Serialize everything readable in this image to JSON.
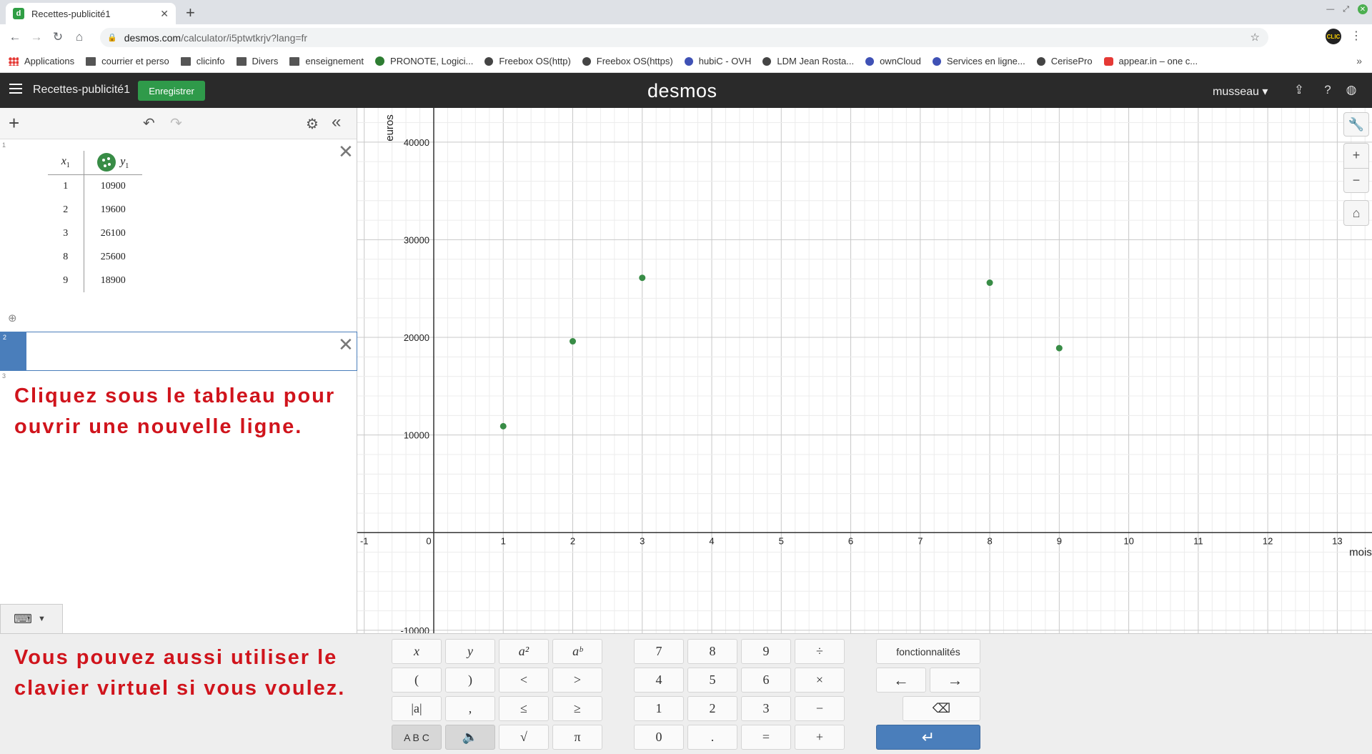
{
  "browser": {
    "tab_title": "Recettes-publicité1",
    "url_host": "desmos.com",
    "url_path": "/calculator/i5ptwtkrjv?lang=fr",
    "bookmarks": [
      {
        "label": "Applications",
        "icon": "apps"
      },
      {
        "label": "courrier et perso",
        "icon": "folder"
      },
      {
        "label": "clicinfo",
        "icon": "folder"
      },
      {
        "label": "Divers",
        "icon": "folder"
      },
      {
        "label": "enseignement",
        "icon": "folder"
      },
      {
        "label": "PRONOTE, Logici...",
        "icon": "green"
      },
      {
        "label": "Freebox OS(http)",
        "icon": "dot"
      },
      {
        "label": "Freebox OS(https)",
        "icon": "dot"
      },
      {
        "label": "hubiC - OVH",
        "icon": "blue"
      },
      {
        "label": "LDM Jean Rosta...",
        "icon": "dot"
      },
      {
        "label": "ownCloud",
        "icon": "blue"
      },
      {
        "label": "Services en ligne...",
        "icon": "blue"
      },
      {
        "label": "CerisePro",
        "icon": "dot"
      },
      {
        "label": "appear.in – one c...",
        "icon": "red"
      }
    ]
  },
  "header": {
    "graph_title": "Recettes-publicité1",
    "save_label": "Enregistrer",
    "logo": "desmos",
    "user": "musseau"
  },
  "expressions": {
    "row_numbers": [
      "1",
      "2",
      "3"
    ],
    "table": {
      "col1_header": "x",
      "col1_sub": "1",
      "col2_header": "y",
      "col2_sub": "1",
      "rows": [
        {
          "x": "1",
          "y": "10900"
        },
        {
          "x": "2",
          "y": "19600"
        },
        {
          "x": "3",
          "y": "26100"
        },
        {
          "x": "8",
          "y": "25600"
        },
        {
          "x": "9",
          "y": "18900"
        }
      ],
      "point_color": "#388c46"
    }
  },
  "annotations": {
    "top": [
      "Cliquez sous le tableau pour",
      "ouvrir une nouvelle ligne."
    ],
    "bottom": [
      "Vous pouvez aussi utiliser le",
      "clavier virtuel si vous voulez."
    ]
  },
  "chart_data": {
    "type": "scatter",
    "xlabel": "mois",
    "ylabel": "euros",
    "xlim": [
      -1.1,
      13.5
    ],
    "ylim": [
      -10300,
      43500
    ],
    "x_ticks": [
      -1,
      0,
      1,
      2,
      3,
      4,
      5,
      6,
      7,
      8,
      9,
      10,
      11,
      12,
      13
    ],
    "y_ticks": [
      -10000,
      10000,
      20000,
      30000,
      40000
    ],
    "grid": true,
    "series": [
      {
        "x": [
          1,
          2,
          3,
          8,
          9
        ],
        "y": [
          10900,
          19600,
          26100,
          25600,
          18900
        ],
        "color": "#388c46"
      }
    ]
  },
  "keypad": {
    "left": [
      [
        "x",
        "y",
        "a²",
        "aᵇ"
      ],
      [
        "(",
        ")",
        "<",
        ">"
      ],
      [
        "|a|",
        ",",
        "≤",
        "≥"
      ],
      [
        "A B C",
        "🔈",
        "√",
        "π"
      ]
    ],
    "middle": [
      [
        "7",
        "8",
        "9",
        "÷"
      ],
      [
        "4",
        "5",
        "6",
        "×"
      ],
      [
        "1",
        "2",
        "3",
        "−"
      ],
      [
        "0",
        ".",
        "=",
        "+"
      ]
    ],
    "functions_label": "fonctionnalités",
    "left_arrow": "←",
    "right_arrow": "→",
    "backspace": "⌫",
    "enter": "↵"
  }
}
